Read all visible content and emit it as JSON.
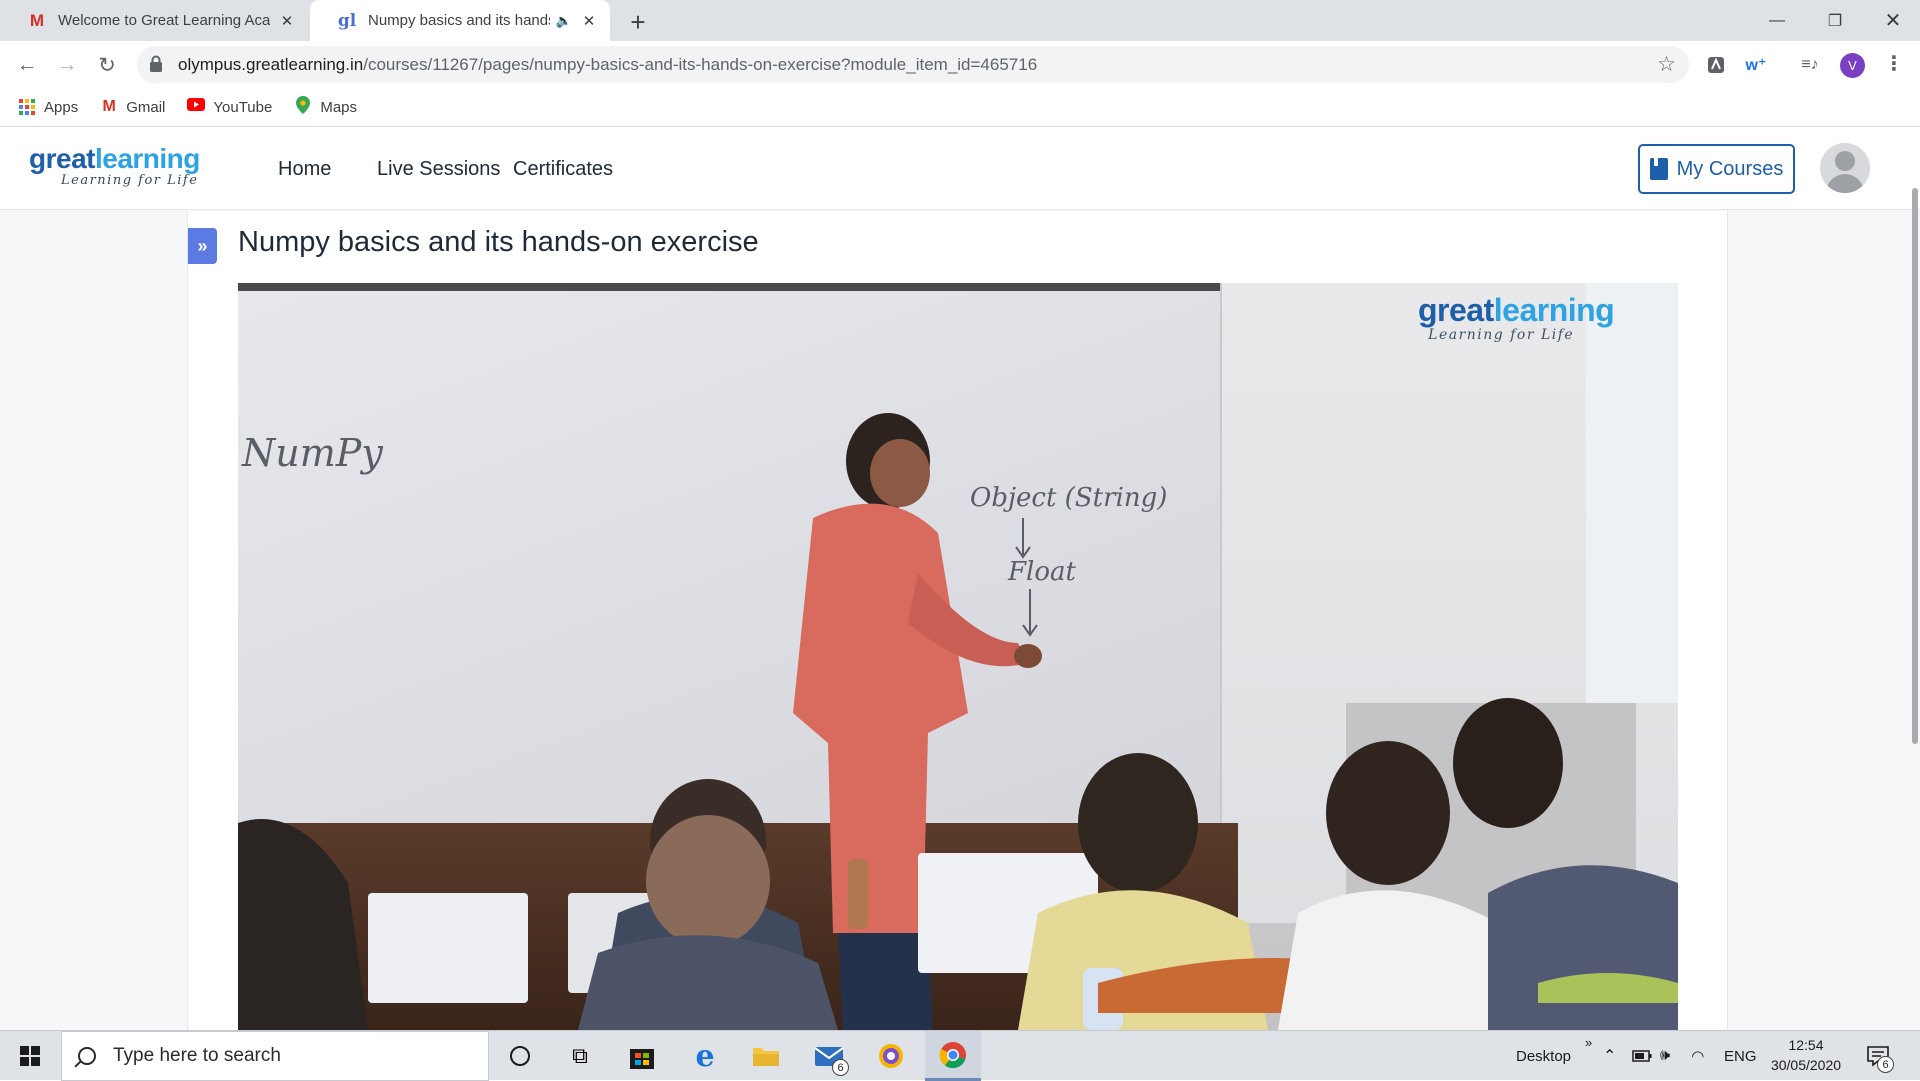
{
  "browser": {
    "tabs": [
      {
        "title": "Welcome to Great Learning Acad",
        "icon": "gmail-icon",
        "active": false
      },
      {
        "title": "Numpy basics and its hands-",
        "icon": "greatlearning-icon",
        "active": true,
        "muted": true
      }
    ],
    "url_host": "olympus.greatlearning.in",
    "url_path": "/courses/11267/pages/numpy-basics-and-its-hands-on-exercise?module_item_id=465716",
    "profile_initial": "V",
    "bookmarks": [
      {
        "label": "Apps",
        "icon": "apps-grid-icon"
      },
      {
        "label": "Gmail",
        "icon": "gmail-icon"
      },
      {
        "label": "YouTube",
        "icon": "youtube-icon"
      },
      {
        "label": "Maps",
        "icon": "maps-pin-icon"
      }
    ]
  },
  "site": {
    "logo_word_1": "great",
    "logo_word_2": "learning",
    "logo_tagline": "Learning for Life",
    "nav": [
      "Home",
      "Live Sessions",
      "Certificates"
    ],
    "my_courses_label": "My Courses",
    "page_title": "Numpy basics and its hands-on exercise"
  },
  "video": {
    "watermark_word_1": "great",
    "watermark_word_2": "learning",
    "watermark_tagline": "Learning for Life",
    "board_text": {
      "numpy": "NumPy",
      "object": "Object (String)",
      "float": "Float"
    }
  },
  "taskbar": {
    "search_placeholder": "Type here to search",
    "mail_badge": "6",
    "desktop_label": "Desktop",
    "language": "ENG",
    "time": "12:54",
    "date": "30/05/2020",
    "notification_count": "6"
  },
  "colors": {
    "brand_dark": "#1d5fa8",
    "brand_light": "#2ea3e3",
    "sidebar_toggle": "#5b7be3"
  }
}
